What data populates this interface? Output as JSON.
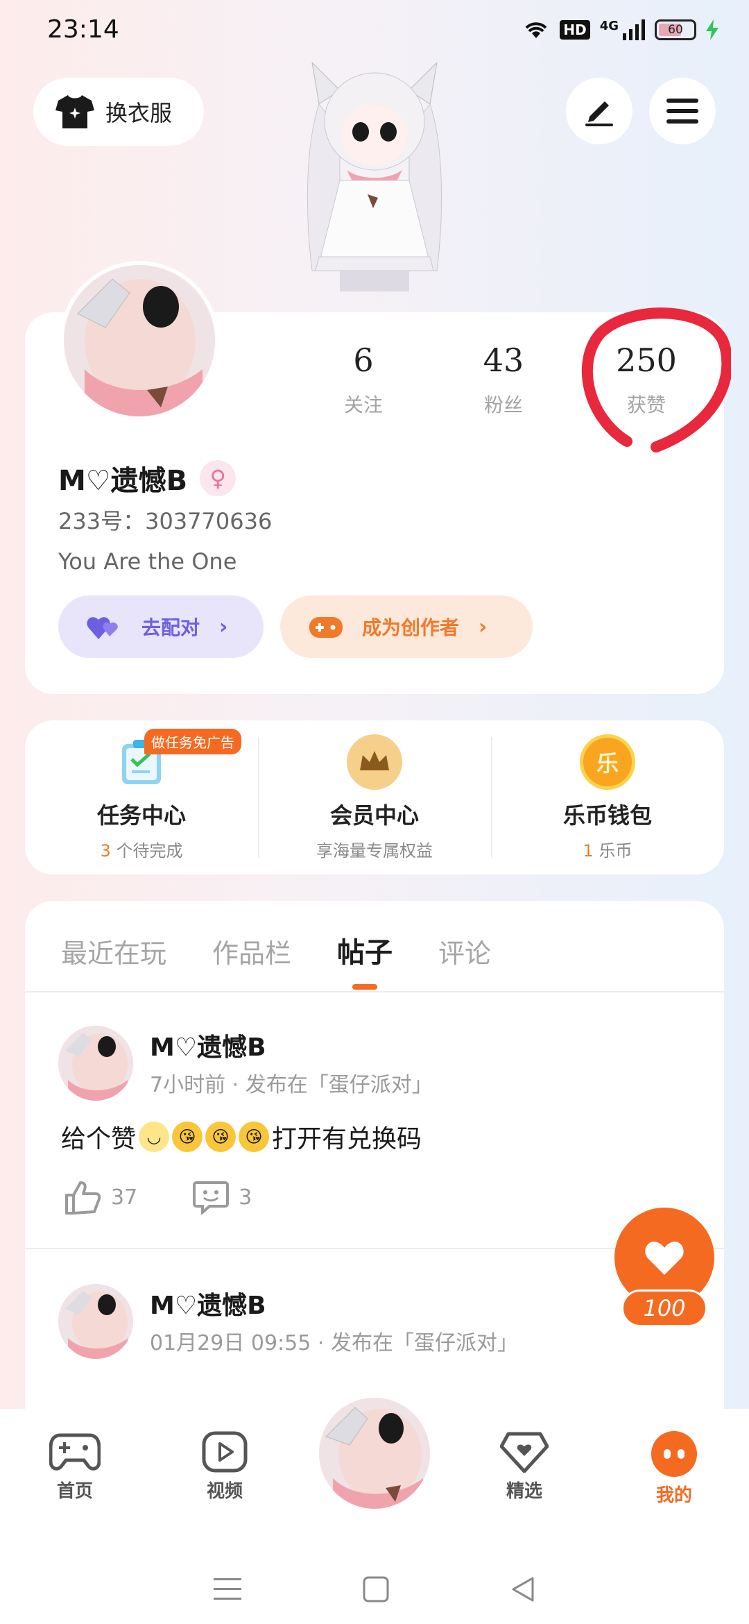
{
  "status_bar": {
    "time": "23:14",
    "hd": "HD",
    "network": "4G",
    "battery": "60",
    "icons": [
      "wifi-icon",
      "signal-icon",
      "battery-icon",
      "charging-icon"
    ]
  },
  "header": {
    "outfit_label": "换衣服",
    "icons": [
      "tshirt-icon",
      "edit-icon",
      "menu-icon"
    ]
  },
  "profile": {
    "stats": [
      {
        "value": "6",
        "label": "关注"
      },
      {
        "value": "43",
        "label": "粉丝"
      },
      {
        "value": "250",
        "label": "获赞"
      }
    ],
    "nickname": "M♡遗憾B",
    "uid": "233号：303770636",
    "bio": "You Are the One",
    "pair_button": "去配对",
    "creator_button": "成为创作者"
  },
  "services": [
    {
      "title": "任务中心",
      "sub_highlight": "3",
      "sub": " 个待完成",
      "tag": "做任务免广告",
      "icon": "clipboard-icon"
    },
    {
      "title": "会员中心",
      "sub_highlight": "",
      "sub": "享海量专属权益",
      "tag": "",
      "icon": "crown-icon"
    },
    {
      "title": "乐币钱包",
      "sub_highlight": "1",
      "sub": " 乐币",
      "tag": "",
      "icon": "coin-icon",
      "coin_char": "乐"
    }
  ],
  "tabs": [
    {
      "label": "最近在玩",
      "active": false
    },
    {
      "label": "作品栏",
      "active": false
    },
    {
      "label": "帖子",
      "active": true
    },
    {
      "label": "评论",
      "active": false
    }
  ],
  "posts": [
    {
      "author": "M♡遗憾B",
      "meta": "7小时前 · 发布在「蛋仔派对」",
      "content_prefix": "给个赞",
      "content_suffix": "打开有兑换码",
      "likes": "37",
      "comments": "3"
    },
    {
      "author": "M♡遗憾B",
      "meta": "01月29日 09:55 · 发布在「蛋仔派对」"
    }
  ],
  "floating_like": {
    "count": "100"
  },
  "bottom_nav": [
    {
      "label": "首页",
      "icon": "gamepad-icon",
      "active": false
    },
    {
      "label": "视频",
      "icon": "play-icon",
      "active": false
    },
    {
      "label": "",
      "icon": "avatar",
      "active": false
    },
    {
      "label": "精选",
      "icon": "heart-badge-icon",
      "active": false
    },
    {
      "label": "我的",
      "icon": "me-icon",
      "active": true
    }
  ],
  "colors": {
    "accent": "#f56a21",
    "pair": "#6e5fe0",
    "annotation": "#e8283c"
  }
}
